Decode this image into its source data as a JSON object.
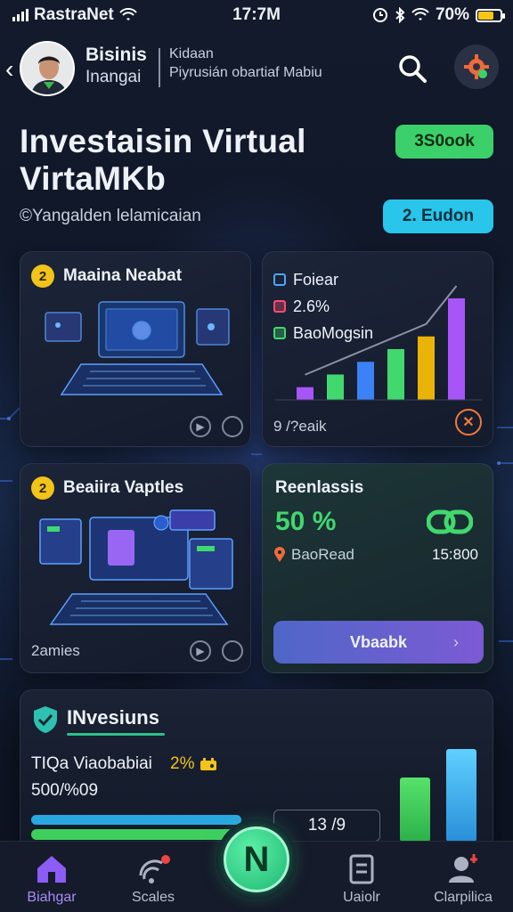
{
  "status_bar": {
    "carrier": "RastraNet",
    "time": "17:7M",
    "battery": "70%",
    "battery_level": 0.7
  },
  "header": {
    "user_name": "Bisinis",
    "user_subtitle": "Inangai",
    "sub_line1": "Kidaan",
    "sub_line2": "Piyrusián obartiaf Mabiu"
  },
  "hero": {
    "title_line1": "Investaisin Virtual",
    "title_line2": "VirtaMKb",
    "subtitle": "©Yangalden lelamicaian",
    "pill_green": "3S0ook",
    "pill_cyan": "2. Eudon"
  },
  "card1": {
    "badge": "2",
    "title": "Maaina Neabat"
  },
  "card2": {
    "legend": [
      {
        "label": "Foiear",
        "color": "#4aa8ff"
      },
      {
        "label": "2.6%",
        "color": "#ff4d6d"
      },
      {
        "label": "BaoMogsin",
        "color": "#41d86e"
      }
    ],
    "footer": "9 /?eaik",
    "chart_data": {
      "type": "bar",
      "values": [
        1,
        2,
        3,
        4,
        5,
        8
      ],
      "colors": [
        "#a855f7",
        "#41d86e",
        "#3b82f6",
        "#41d86e",
        "#eab308",
        "#a855f7"
      ]
    }
  },
  "card3": {
    "badge": "2",
    "title": "Beaiira Vaptles",
    "footer": "2amies"
  },
  "card4": {
    "title": "Reenlassis",
    "value": "50 %",
    "sub_label": "BaoRead",
    "sub_value": "15:800",
    "cta": "Vbaabk"
  },
  "card5": {
    "title": "INvesiuns",
    "row1_label": "TIQa Viaobabiai",
    "row1_value": "2%",
    "row2": "500/%09",
    "box_text": "13 /9"
  },
  "nav": {
    "items": [
      {
        "label": "Biahgar"
      },
      {
        "label": "Scales"
      },
      {
        "label": "Uaiolr"
      },
      {
        "label": "Clarpilica"
      }
    ],
    "fab": "N"
  }
}
